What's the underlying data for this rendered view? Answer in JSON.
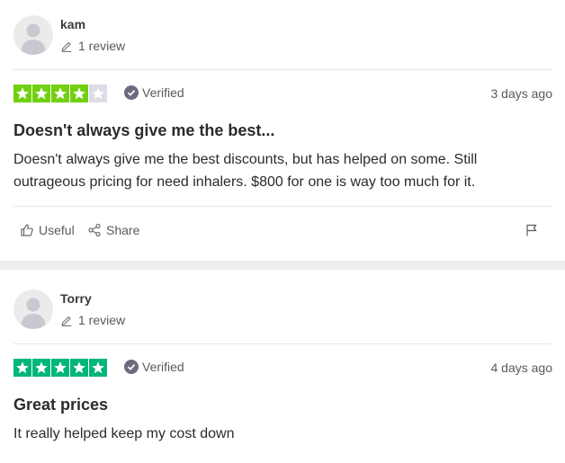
{
  "colors": {
    "star_green_4": "#73cf11",
    "star_green_5": "#00b67a",
    "star_empty": "#dcdce6",
    "verified_badge": "#6b6b80"
  },
  "reviews": [
    {
      "username": "kam",
      "review_count": "1 review",
      "rating": 4,
      "verified_label": "Verified",
      "date": "3 days ago",
      "title": "Doesn't always give me the best...",
      "body": "Doesn't always give me the best discounts, but has helped on some. Still outrageous pricing for need inhalers. $800 for one is way too much for it.",
      "actions": {
        "useful": "Useful",
        "share": "Share"
      }
    },
    {
      "username": "Torry",
      "review_count": "1 review",
      "rating": 5,
      "verified_label": "Verified",
      "date": "4 days ago",
      "title": "Great prices",
      "body": "It really helped keep my cost down"
    }
  ]
}
